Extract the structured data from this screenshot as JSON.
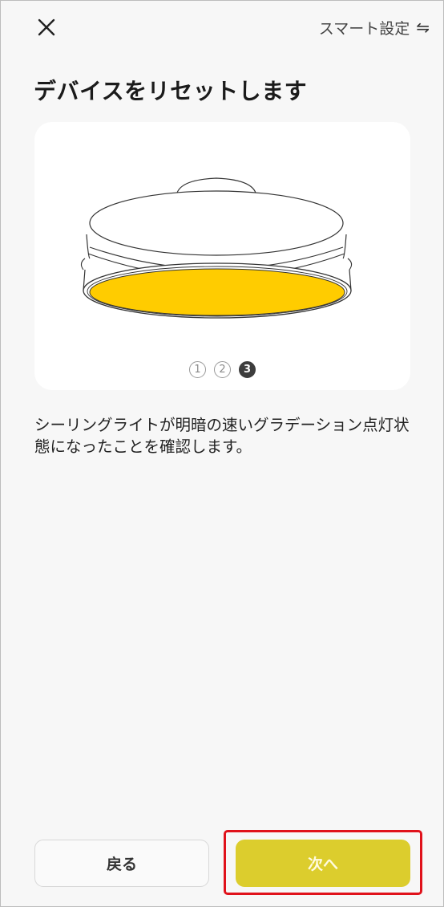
{
  "header": {
    "close_icon": "close-icon",
    "smart_settings_label": "スマート設定",
    "swap_icon": "⇋"
  },
  "page": {
    "title": "デバイスをリセットします",
    "description": "シーリングライトが明暗の速いグラデーション点灯状態になったことを確認します。"
  },
  "illustration": {
    "name": "ceiling-light-illustration",
    "light_color": "#ffcc00"
  },
  "pager": {
    "steps": [
      "1",
      "2",
      "3"
    ],
    "current": 3
  },
  "footer": {
    "back_label": "戻る",
    "next_label": "次へ",
    "next_color": "#dccd2d",
    "highlight_color": "#e0121b"
  }
}
